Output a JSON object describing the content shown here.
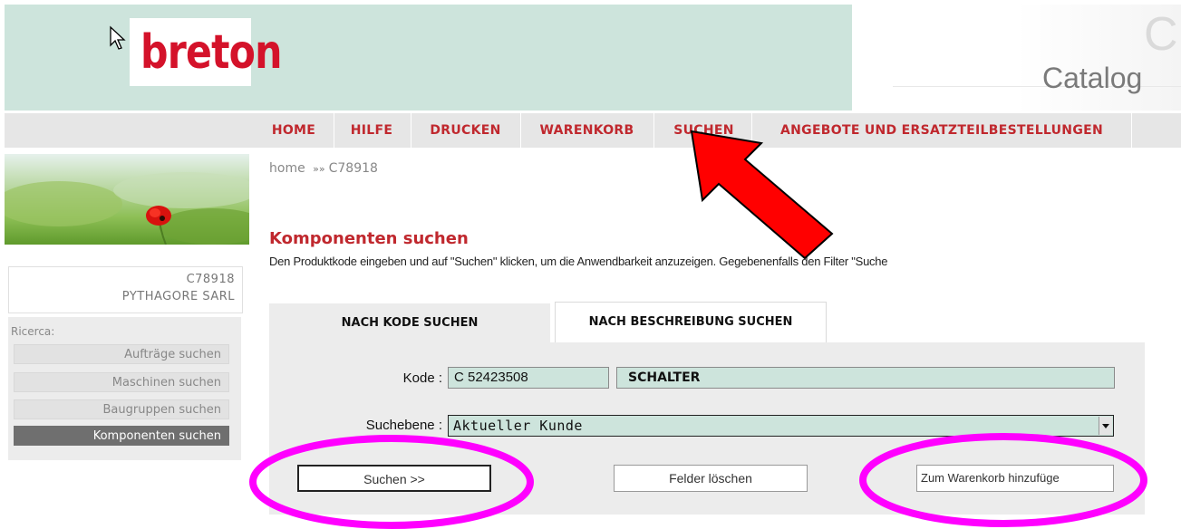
{
  "header": {
    "logo_text": "breton",
    "catalog_letter": "C",
    "catalog_text": "Catalog"
  },
  "nav": {
    "items": [
      {
        "label": "HOME"
      },
      {
        "label": "HILFE"
      },
      {
        "label": "DRUCKEN"
      },
      {
        "label": "WARENKORB"
      },
      {
        "label": "SUCHEN"
      },
      {
        "label": "ANGEBOTE UND ERSATZTEILBESTELLUNGEN"
      }
    ]
  },
  "breadcrumb": {
    "home": "home",
    "separator": "»»",
    "current": "C78918"
  },
  "sidebar": {
    "user_code": "C78918",
    "user_name": "PYTHAGORE SARL",
    "ricerca_label": "Ricerca:",
    "items": [
      {
        "label": "Aufträge suchen",
        "active": false
      },
      {
        "label": "Maschinen suchen",
        "active": false
      },
      {
        "label": "Baugruppen suchen",
        "active": false
      },
      {
        "label": "Komponenten suchen",
        "active": true
      }
    ]
  },
  "main": {
    "title": "Komponenten suchen",
    "description": "Den Produktkode eingeben und auf \"Suchen\" klicken, um die Anwendbarkeit anzuzeigen. Gegebenenfalls den Filter \"Suche",
    "tabs": [
      {
        "label": "NACH KODE SUCHEN",
        "active": true
      },
      {
        "label": "NACH BESCHREIBUNG SUCHEN",
        "active": false
      }
    ],
    "form": {
      "kode_label": "Kode :",
      "kode_value": "C 52423508",
      "description_value": "SCHALTER",
      "suchebene_label": "Suchebene :",
      "suchebene_value": "Aktueller Kunde"
    },
    "buttons": {
      "search": "Suchen >>",
      "clear": "Felder löschen",
      "add_to_cart": "Zum Warenkorb hinzufüge"
    }
  },
  "colors": {
    "accent_red": "#c0282e",
    "header_mint": "#cde4dc",
    "annotation_magenta": "#ff00ff",
    "annotation_arrow": "#ff0000"
  }
}
